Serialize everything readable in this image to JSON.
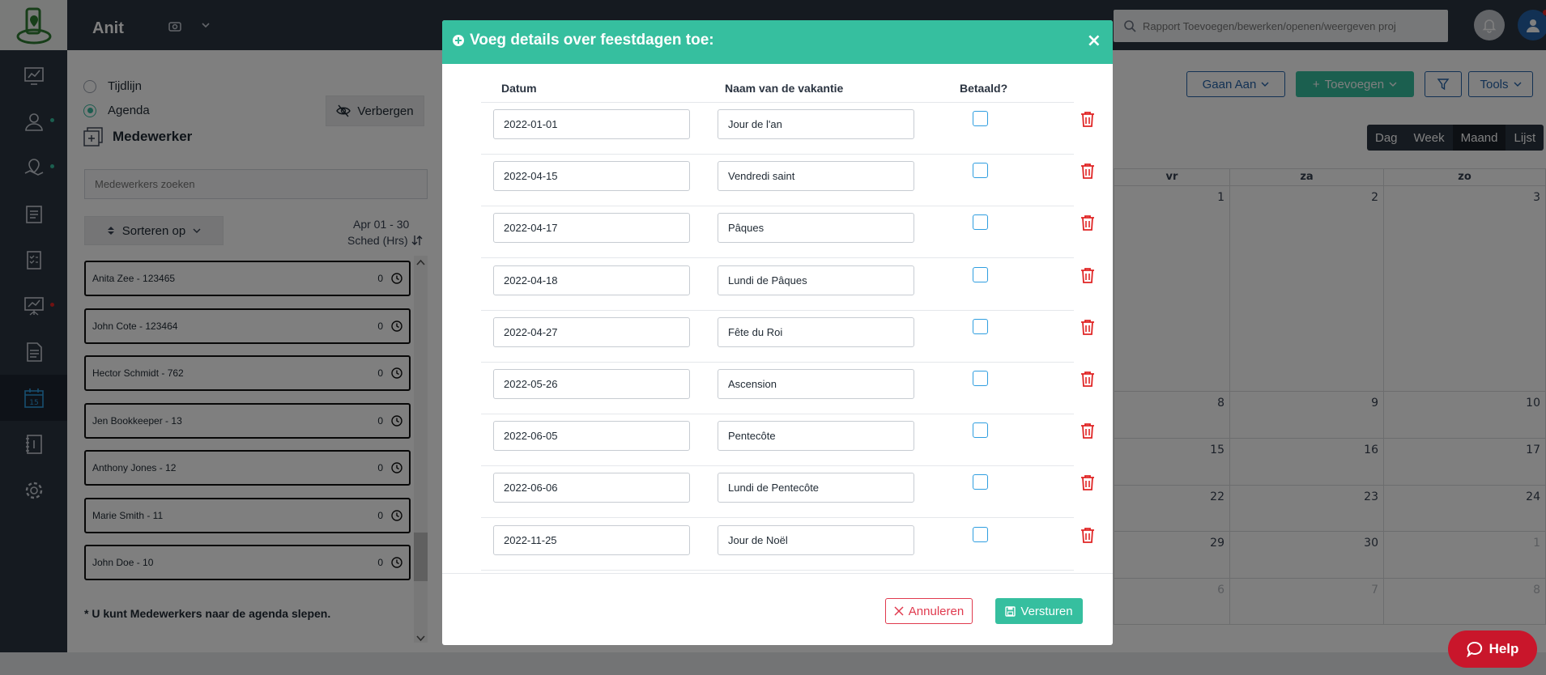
{
  "app": {
    "name": "Anit",
    "search_placeholder": "Rapport Toevoegen/bewerken/openen/weergeven proj"
  },
  "rail": {
    "items": [
      {
        "icon": "dashboard-chart-icon",
        "dot": ""
      },
      {
        "icon": "user-icon",
        "dot": "#36bf9f"
      },
      {
        "icon": "map-pin-icon",
        "dot": "#36bf9f"
      },
      {
        "icon": "clipboard-icon",
        "dot": ""
      },
      {
        "icon": "checklist-icon",
        "dot": ""
      },
      {
        "icon": "presentation-chart-icon",
        "dot": "#e02424"
      },
      {
        "icon": "document-icon",
        "dot": ""
      },
      {
        "icon": "calendar-icon",
        "dot": "",
        "active": true
      },
      {
        "icon": "notebook-icon",
        "dot": ""
      },
      {
        "icon": "settings-gear-icon",
        "dot": ""
      }
    ]
  },
  "panel": {
    "view_options": [
      {
        "label": "Tijdlijn",
        "selected": false
      },
      {
        "label": "Agenda",
        "selected": true
      }
    ],
    "hide_label": "Verbergen",
    "section_title": "Medewerker",
    "search_placeholder": "Medewerkers zoeken",
    "sort_label": "Sorteren op",
    "range_label": "Apr 01 - 30",
    "sched_label": "Sched (Hrs)",
    "employees": [
      {
        "name": "Anita Zee - 123465",
        "hours": "0"
      },
      {
        "name": "John Cote - 123464",
        "hours": "0"
      },
      {
        "name": "Hector Schmidt - 762",
        "hours": "0"
      },
      {
        "name": "Jen Bookkeeper - 13",
        "hours": "0"
      },
      {
        "name": "Anthony Jones - 12",
        "hours": "0"
      },
      {
        "name": "Marie Smith - 11",
        "hours": "0"
      },
      {
        "name": "John Doe - 10",
        "hours": "0"
      }
    ],
    "drag_note": "* U kunt Medewerkers naar de agenda slepen."
  },
  "toolbar": {
    "goto_label": "Gaan Aan",
    "add_label": "Toevoegen",
    "tools_label": "Tools",
    "views": [
      {
        "label": "Dag",
        "selected": false
      },
      {
        "label": "Week",
        "selected": false
      },
      {
        "label": "Maand",
        "selected": true
      },
      {
        "label": "Lijst",
        "selected": false
      }
    ]
  },
  "calendar": {
    "days": [
      "vr",
      "za",
      "zo"
    ],
    "weeks": [
      [
        {
          "n": "1"
        },
        {
          "n": "2"
        },
        {
          "n": "3"
        }
      ],
      [
        {
          "n": "8"
        },
        {
          "n": "9"
        },
        {
          "n": "10"
        }
      ],
      [
        {
          "n": "15"
        },
        {
          "n": "16"
        },
        {
          "n": "17"
        }
      ],
      [
        {
          "n": "22"
        },
        {
          "n": "23"
        },
        {
          "n": "24"
        }
      ],
      [
        {
          "n": "29"
        },
        {
          "n": "30"
        },
        {
          "n": "1",
          "dim": true
        }
      ],
      [
        {
          "n": "6",
          "dim": true
        },
        {
          "n": "7",
          "dim": true
        },
        {
          "n": "8",
          "dim": true
        }
      ]
    ]
  },
  "modal": {
    "title": "Voeg details over feestdagen toe:",
    "columns": {
      "date": "Datum",
      "name": "Naam van de vakantie",
      "paid": "Betaald?"
    },
    "holidays": [
      {
        "date": "2022-01-01",
        "name": "Jour de l'an",
        "paid": false
      },
      {
        "date": "2022-04-15",
        "name": "Vendredi saint",
        "paid": false
      },
      {
        "date": "2022-04-17",
        "name": "Pâques",
        "paid": false
      },
      {
        "date": "2022-04-18",
        "name": "Lundi de Pâques",
        "paid": false
      },
      {
        "date": "2022-04-27",
        "name": "Fête du Roi",
        "paid": false
      },
      {
        "date": "2022-05-26",
        "name": "Ascension",
        "paid": false
      },
      {
        "date": "2022-06-05",
        "name": "Pentecôte",
        "paid": false
      },
      {
        "date": "2022-06-06",
        "name": "Lundi de Pentecôte",
        "paid": false
      },
      {
        "date": "2022-11-25",
        "name": "Jour de Noël",
        "paid": false
      }
    ],
    "cancel_label": "Annuleren",
    "submit_label": "Versturen"
  },
  "help_label": "Help",
  "colors": {
    "accent": "#36bf9f",
    "danger": "#e03a4e",
    "rail": "#2b3441",
    "checkbox": "#2f9ee0"
  }
}
